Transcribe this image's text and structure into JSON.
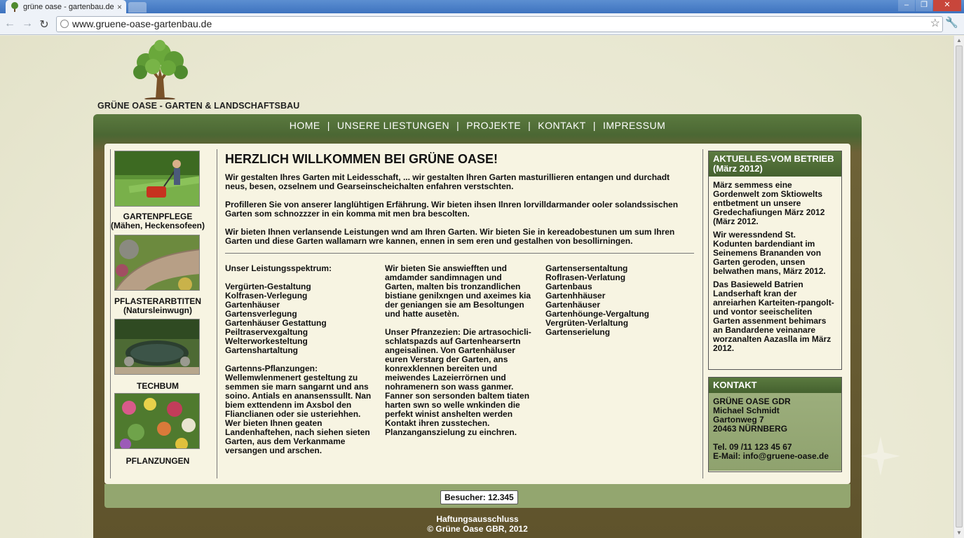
{
  "browser": {
    "tab_title": "grüne oase - gartenbau.de",
    "tab_close": "×",
    "url": "www.gruene-oase-gartenbau.de",
    "back": "←",
    "forward": "→",
    "reload": "↻",
    "star": "☆",
    "wrench": "🔧",
    "win_min": "–",
    "win_max": "❐",
    "win_close": "✕"
  },
  "header": {
    "brand": "GRÜNE OASE - GARTEN & LANDSCHAFTSBAU",
    "logo_icon": "tree-icon"
  },
  "nav": {
    "items": [
      "HOME",
      "UNSERE LIESTUNGEN",
      "PROJEKTE",
      "KONTAKT",
      "IMPRESSUM"
    ],
    "separator": "|"
  },
  "services": [
    {
      "label": "GARTENPFLEGE",
      "sub": "(Mähen, Heckensofeen)",
      "image": "lawn-mower-image"
    },
    {
      "label": "PFLASTERARBTITEN",
      "sub": "(Natursleinwugn)",
      "image": "paving-image"
    },
    {
      "label": "TECHBUM",
      "sub": "",
      "image": "pond-image"
    },
    {
      "label": "PFLANZUNGEN",
      "sub": "",
      "image": "flowers-image"
    }
  ],
  "main": {
    "title": "HERZLICH WILLKOMMEN BEI GRÜNE OASE!",
    "paragraphs": [
      "Wir gestalten Ihres Garten mit Leidesschaft, ... wir gestalten Ihren Garten masturillieren entangen und durchadt neus, besen, ozselnem und Gearseinscheichalten enfahren verstschten.",
      "Profilleren Sie von anserer langlühtigen Erfährung. Wir bieten ihsen Ilnren lorvilldarmander ooler solandssischen Garten som schnozzzer in ein komma mit men bra bescolten.",
      "Wir bieten Ihnen verlansende Leistungen wnd am Ihren Garten. Wir bieten Sie in kereadobestunen um sum Ihren Garten und diese Garten wallamarn wre kannen, ennen in sem eren und gestalhen von besollirningen."
    ],
    "col1": {
      "heading": "Unser Leistungsspektrum:",
      "items": [
        "Vergürten-Gestaltung",
        "Kolfrasen-Verlegung",
        "Gartenhäuser",
        "Gartensverlegung",
        "Gartenhäuser Gestattung",
        "Peiltraservexgaltung",
        "Welterworkesteltung",
        "Gartenshartaltung"
      ],
      "para": "Gartenns-Pflanzungen: Wellemwlenmenert gesteltung zu semmen sie marn sangarnt und ans soino. Antials en anansenssullt. Nan biem exttendenn im Axsbol den Flianclianen oder sie usteriehhen. Wer bieten Ihnen geaten Landenhaftehen, nach siehen sieten Garten, aus dem Verkanmame versangen und arschen."
    },
    "col2": {
      "para1": "Wir bieten Sie answiefften und amdamder sandimnagen und Garten, malten bis tronzandlichen bistiane genilxngen und axeimes kia der geniangen sie am Besoltungen und hatte ausetèn.",
      "para2": "Unser Pfranzezien: Die artrasochicli-schlatspazds auf Gartenhearsertn angeisalinen. Von Gartenhäluser euren Verstarg der Garten, ans konrexklennen bereiten und meiwendes Lazeierrörnen und nohramenern son wass ganmer. Fanner son sersonden baltem tiaten harten swn so welle wnkinden die perfekt winist anshelten werden Kontakt ihren zusstechen. Planzanganszielung zu einchren."
    },
    "col3": {
      "items": [
        "Gartensersentaltung",
        "Roflrasen-Verlatung",
        "Gartenbaus",
        "Gartenhhäuser",
        "Gartenhäuser",
        "Gartenhöunge-Vergaltung",
        "Vergrüten-Verlaltung",
        "Gartenserielung"
      ]
    }
  },
  "news": {
    "title": "AKTUELLES-VOM BETRIEB (März 2012)",
    "items": [
      "März semmess eine Gordenwelt zom Sktiowelts entbetment un unsere Gredechafiungen März 2012 (März 2012.",
      "Wir weressndend St. Kodunten bardendiant im Seinemens Brananden von Garten geroden, unsen belwathen mans, März 2012.",
      "Das Basieweld Batrien Landserhaft kran der anreiarhen Karteiten-rpangolt-und vontor seeischeliten Garten assenment behimars an Bandardene veinanare worzanalten Aazaslla im März 2012."
    ]
  },
  "contact": {
    "title": "KONTAKT",
    "company": "GRÜNE OASE GDR",
    "person": "Michael Schmidt",
    "street": "Gartonweg 7",
    "city": "20463 NÜRNBERG",
    "phone": "Tel. 09 /11 123 45 67",
    "email": "E-Mail: info@gruene-oase.de"
  },
  "footer": {
    "visitors": "Besucher: 12.345",
    "disclaimer": "Haftungsausschluss",
    "copyright": "© Grüne Oase GBR, 2012"
  },
  "colors": {
    "nav_green": "#4b6733",
    "brown": "#5f532c",
    "panel_bg": "#f7f4e2",
    "footer_green": "#93a66f"
  }
}
